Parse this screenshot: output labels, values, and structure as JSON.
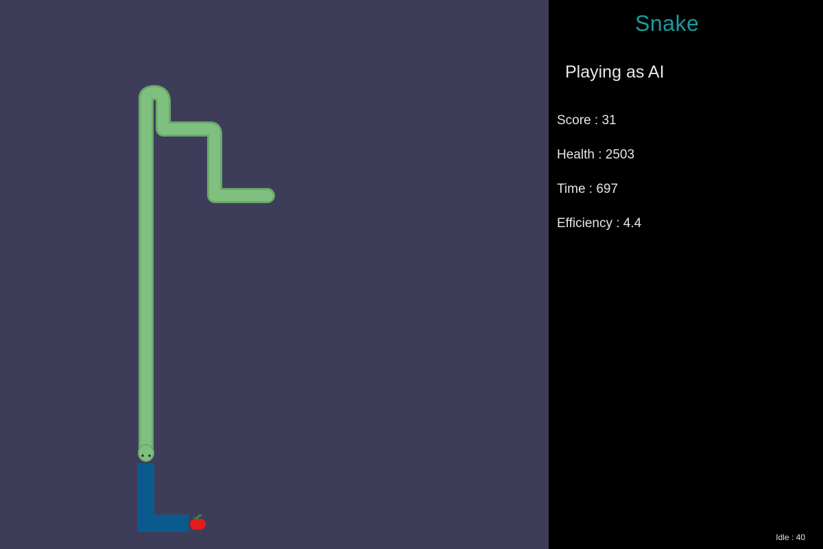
{
  "game": {
    "title": "Snake",
    "mode": "Playing as AI",
    "colors": {
      "board": "#3d3d5a",
      "panel": "#000000",
      "title": "#1a9ba0",
      "snake_body": "#7fbf7f",
      "snake_outline": "#6aaa6a",
      "path_marker": "#0b5a8e",
      "apple": "#e31b1b",
      "apple_leaf": "#2aa02a"
    },
    "icons": {
      "snake": "snake-body",
      "apple": "apple-icon",
      "path": "planned-path-marker"
    }
  },
  "stats": {
    "score": "Score : 31",
    "health": "Health : 2503",
    "time": "Time : 697",
    "efficiency": "Efficiency : 4.4"
  },
  "footer": {
    "idle": "Idle : 40"
  }
}
